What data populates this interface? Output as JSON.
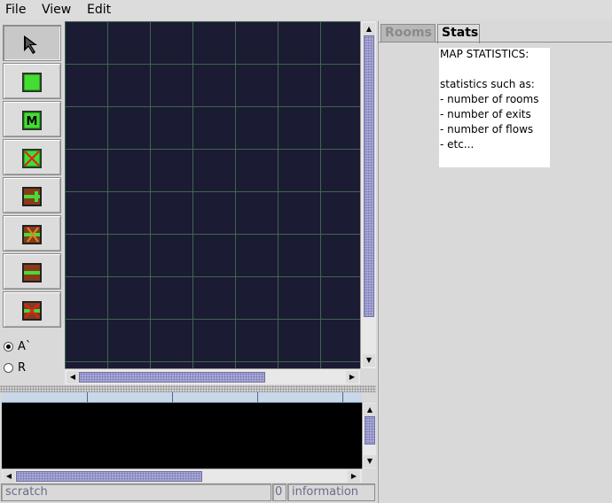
{
  "menubar": {
    "items": [
      {
        "label": "File"
      },
      {
        "label": "View"
      },
      {
        "label": "Edit"
      }
    ]
  },
  "toolbar": {
    "tools": [
      {
        "icon": "arrow-select-icon",
        "selected": true
      },
      {
        "icon": "room-icon",
        "selected": false
      },
      {
        "icon": "room-m-icon",
        "selected": false
      },
      {
        "icon": "room-delete-icon",
        "selected": false
      },
      {
        "icon": "exit-add-icon",
        "selected": false
      },
      {
        "icon": "exit-delete-icon",
        "selected": false
      },
      {
        "icon": "flow-icon",
        "selected": false
      },
      {
        "icon": "flow-delete-icon",
        "selected": false
      }
    ],
    "radios": [
      {
        "label": "A`",
        "checked": true
      },
      {
        "label": "R",
        "checked": false
      }
    ]
  },
  "status": {
    "scratch": "scratch",
    "count": "0",
    "information": "information"
  },
  "tabs": [
    {
      "label": "Rooms",
      "active": false
    },
    {
      "label": "Stats",
      "active": true
    }
  ],
  "stats": {
    "lines": [
      "MAP STATISTICS:",
      "",
      "statistics such as:",
      " - number of rooms",
      " - number of exits",
      " - number of flows",
      " - etc..."
    ]
  },
  "colors": {
    "map_background": "#1b1b33",
    "grid_line": "#3e6650",
    "scroll_thumb": "#a8a8d8"
  }
}
